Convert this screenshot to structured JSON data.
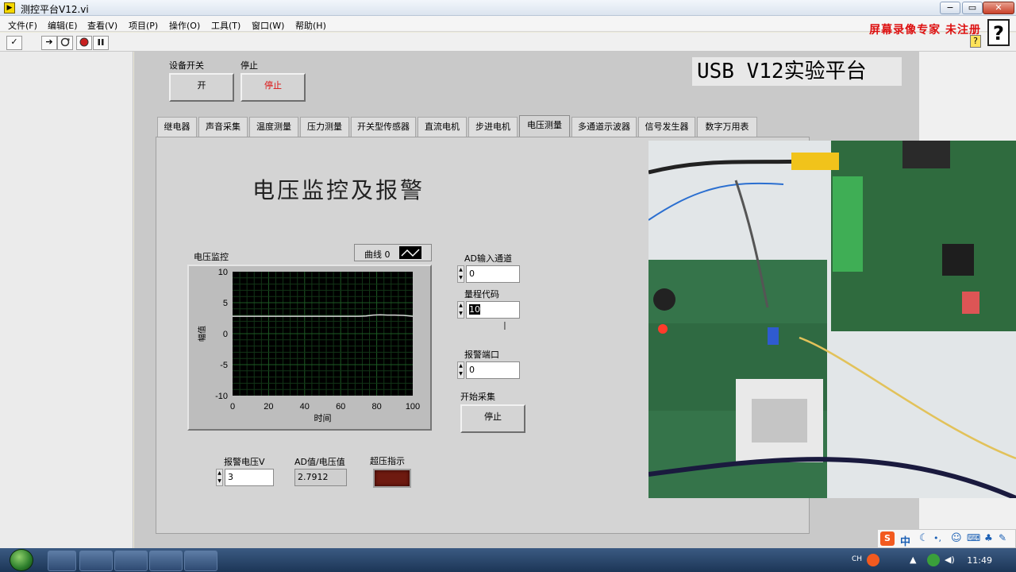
{
  "window": {
    "title": "测控平台V12.vi",
    "minimize": "−",
    "restore": "▭",
    "close": "✕"
  },
  "menu": [
    "文件(F)",
    "编辑(E)",
    "查看(V)",
    "项目(P)",
    "操作(O)",
    "工具(T)",
    "窗口(W)",
    "帮助(H)"
  ],
  "toolbar": {
    "check": "✓",
    "run_arrow": "➔",
    "help_small": "?"
  },
  "watermark": "屏幕录像专家 未注册",
  "help_big": "?",
  "device_switch": {
    "label": "设备开关",
    "button": "开"
  },
  "stop_control": {
    "label": "停止",
    "button": "停止"
  },
  "platform_title": "USB V12实验平台",
  "tabs": [
    "继电器",
    "声音采集",
    "温度测量",
    "压力测量",
    "开关型传感器",
    "直流电机",
    "步进电机",
    "电压测量",
    "多通道示波器",
    "信号发生器",
    "数字万用表"
  ],
  "active_tab": "电压测量",
  "section_title": "电压监控及报警",
  "chart_legend": "曲线 0",
  "ad_channel": {
    "label": "AD输入通道",
    "value": "0"
  },
  "range_code": {
    "label": "量程代码",
    "value": "10"
  },
  "alarm_port": {
    "label": "报警端口",
    "value": "0"
  },
  "start_acq": {
    "label": "开始采集",
    "button": "停止"
  },
  "alarm_voltage": {
    "label": "报警电压V",
    "value": "3"
  },
  "ad_value": {
    "label": "AD值/电压值",
    "value": "2.7912"
  },
  "overvoltage": {
    "label": "超压指示"
  },
  "chart_data": {
    "type": "line",
    "title": "电压监控",
    "xlabel": "时间",
    "ylabel": "幅值",
    "xlim": [
      0,
      100
    ],
    "ylim": [
      -10,
      10
    ],
    "x_ticks": [
      "0",
      "20",
      "40",
      "60",
      "80",
      "100"
    ],
    "y_ticks": [
      "10",
      "5",
      "0",
      "-5",
      "-10"
    ],
    "grid": true,
    "series": [
      {
        "name": "曲线 0",
        "color": "#d8d8d8",
        "x": [
          0,
          10,
          20,
          30,
          40,
          50,
          60,
          70,
          74,
          78,
          82,
          86,
          90,
          95,
          100
        ],
        "y": [
          2.8,
          2.8,
          2.8,
          2.8,
          2.8,
          2.8,
          2.8,
          2.8,
          2.85,
          3.0,
          3.05,
          3.0,
          3.0,
          2.95,
          2.8
        ]
      }
    ]
  },
  "taskbar": {
    "lang": "CH",
    "time": "11:49",
    "ime_s": "S",
    "ime_zh": "中"
  }
}
